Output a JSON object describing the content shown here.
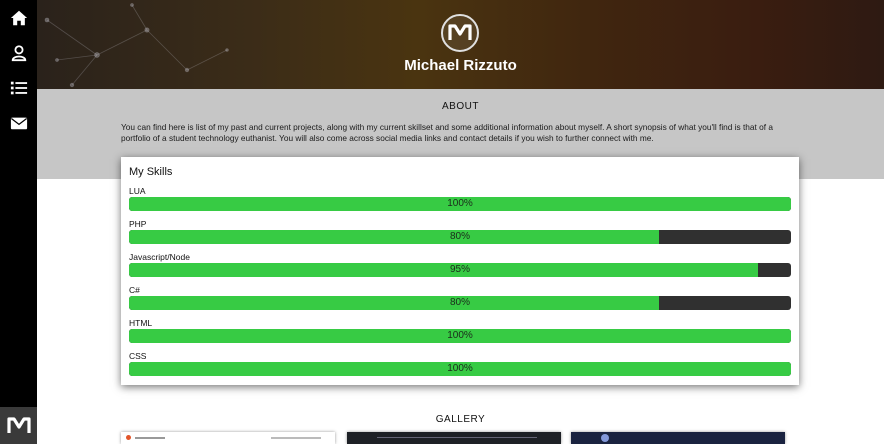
{
  "sidebar": {
    "items": [
      {
        "icon": "home-icon"
      },
      {
        "icon": "user-icon"
      },
      {
        "icon": "list-icon"
      },
      {
        "icon": "envelope-icon"
      }
    ],
    "logo_icon": "mr-logo-icon"
  },
  "header": {
    "name": "Michael Rizzuto",
    "logo_icon": "mr-logo-icon"
  },
  "about": {
    "title": "ABOUT",
    "text": "You can find here is list of my past and current projects, along with my current skillset and some additional information about myself. A short synopsis of what you'll find is that of a portfolio of a student technology euthanist. You will also come across social media links and contact details if you wish to further connect with me."
  },
  "skills": {
    "title": "My Skills",
    "items": [
      {
        "label": "LUA",
        "percent": 100,
        "text": "100%"
      },
      {
        "label": "PHP",
        "percent": 80,
        "text": "80%"
      },
      {
        "label": "Javascript/Node",
        "percent": 95,
        "text": "95%"
      },
      {
        "label": "C#",
        "percent": 80,
        "text": "80%"
      },
      {
        "label": "HTML",
        "percent": 100,
        "text": "100%"
      },
      {
        "label": "CSS",
        "percent": 100,
        "text": "100%"
      }
    ]
  },
  "gallery": {
    "title": "GALLERY"
  },
  "colors": {
    "sidebar": "#000000",
    "bar_fill": "#37cb44",
    "bar_track": "#303030",
    "about_band": "#c6c6c6"
  }
}
